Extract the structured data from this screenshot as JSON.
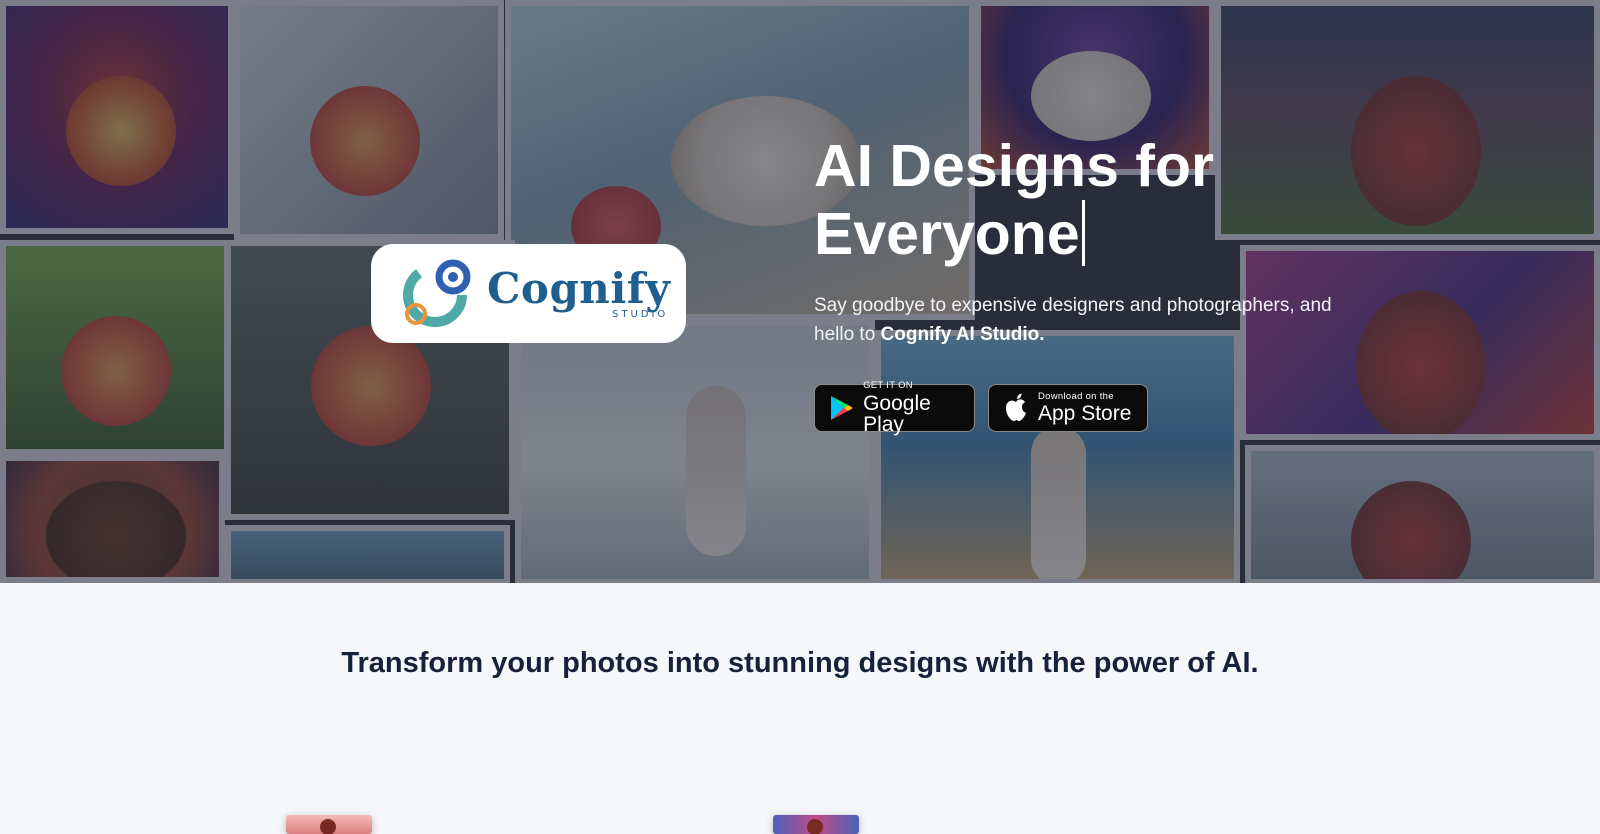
{
  "hero": {
    "headline_line1": "AI Designs for",
    "headline_line2": "Everyone",
    "subtext_plain": "Say goodbye to expensive designers and photographers, and hello to ",
    "subtext_bold": "Cognify AI Studio.",
    "overlay_color": "#282c3a"
  },
  "logo": {
    "word": "Cognify",
    "sub": "STUDIO",
    "icon": "cognify-swirl-logo",
    "brand_color": "#1f5f8f",
    "accent_color": "#e8953a"
  },
  "stores": {
    "google_play": {
      "small": "GET IT ON",
      "big": "Google Play",
      "icon": "google-play-icon"
    },
    "app_store": {
      "small": "Download on the",
      "big": "App Store",
      "icon": "apple-icon"
    }
  },
  "section": {
    "title": "Transform your photos into stunning designs with the power of AI."
  }
}
